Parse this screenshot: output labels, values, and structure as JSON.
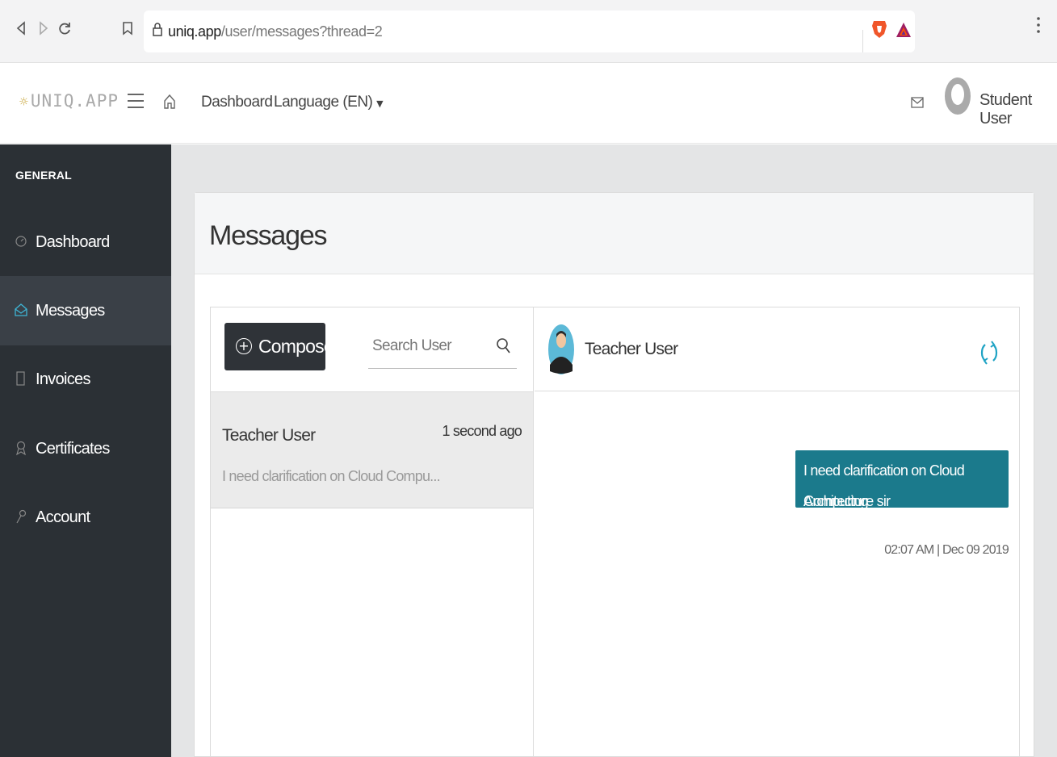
{
  "browser": {
    "url_host": "uniq.app",
    "url_path": "/user/messages?thread=2",
    "back_icon": "back-arrow-icon",
    "forward_icon": "forward-arrow-icon",
    "reload_icon": "reload-icon",
    "bookmark_icon": "bookmark-icon"
  },
  "header": {
    "logo_text": "UNIQ.APP",
    "nav": {
      "dashboard": "Dashboard",
      "language": "Language (EN)",
      "language_caret": "▼"
    },
    "user_name": "Student User"
  },
  "sidebar": {
    "heading": "GENERAL",
    "items": [
      {
        "label": "Dashboard",
        "icon": "gauge-icon",
        "active": false
      },
      {
        "label": "Messages",
        "icon": "envelope-open-icon",
        "active": true
      },
      {
        "label": "Invoices",
        "icon": "document-icon",
        "active": false
      },
      {
        "label": "Certificates",
        "icon": "badge-icon",
        "active": false
      },
      {
        "label": "Account",
        "icon": "key-icon",
        "active": false
      }
    ]
  },
  "main": {
    "title": "Messages",
    "compose_label": "Compose",
    "search": {
      "placeholder": "Search User",
      "value": ""
    },
    "threads": [
      {
        "name": "Teacher User",
        "time": "1 second ago",
        "preview": "I need clarification on Cloud Compu..."
      }
    ],
    "chat": {
      "contact_name": "Teacher User",
      "messages": [
        {
          "line1": "I need clarification on Cloud Computing",
          "line2": "Architecture sir",
          "timestamp": "02:07 AM | Dec 09 2019"
        }
      ]
    }
  },
  "colors": {
    "sidebar_bg": "#2b3035",
    "sidebar_active": "#3a4047",
    "bubble": "#1b7a8c",
    "refresh": "#1fa3c4",
    "compose_bg": "#2f3338"
  }
}
